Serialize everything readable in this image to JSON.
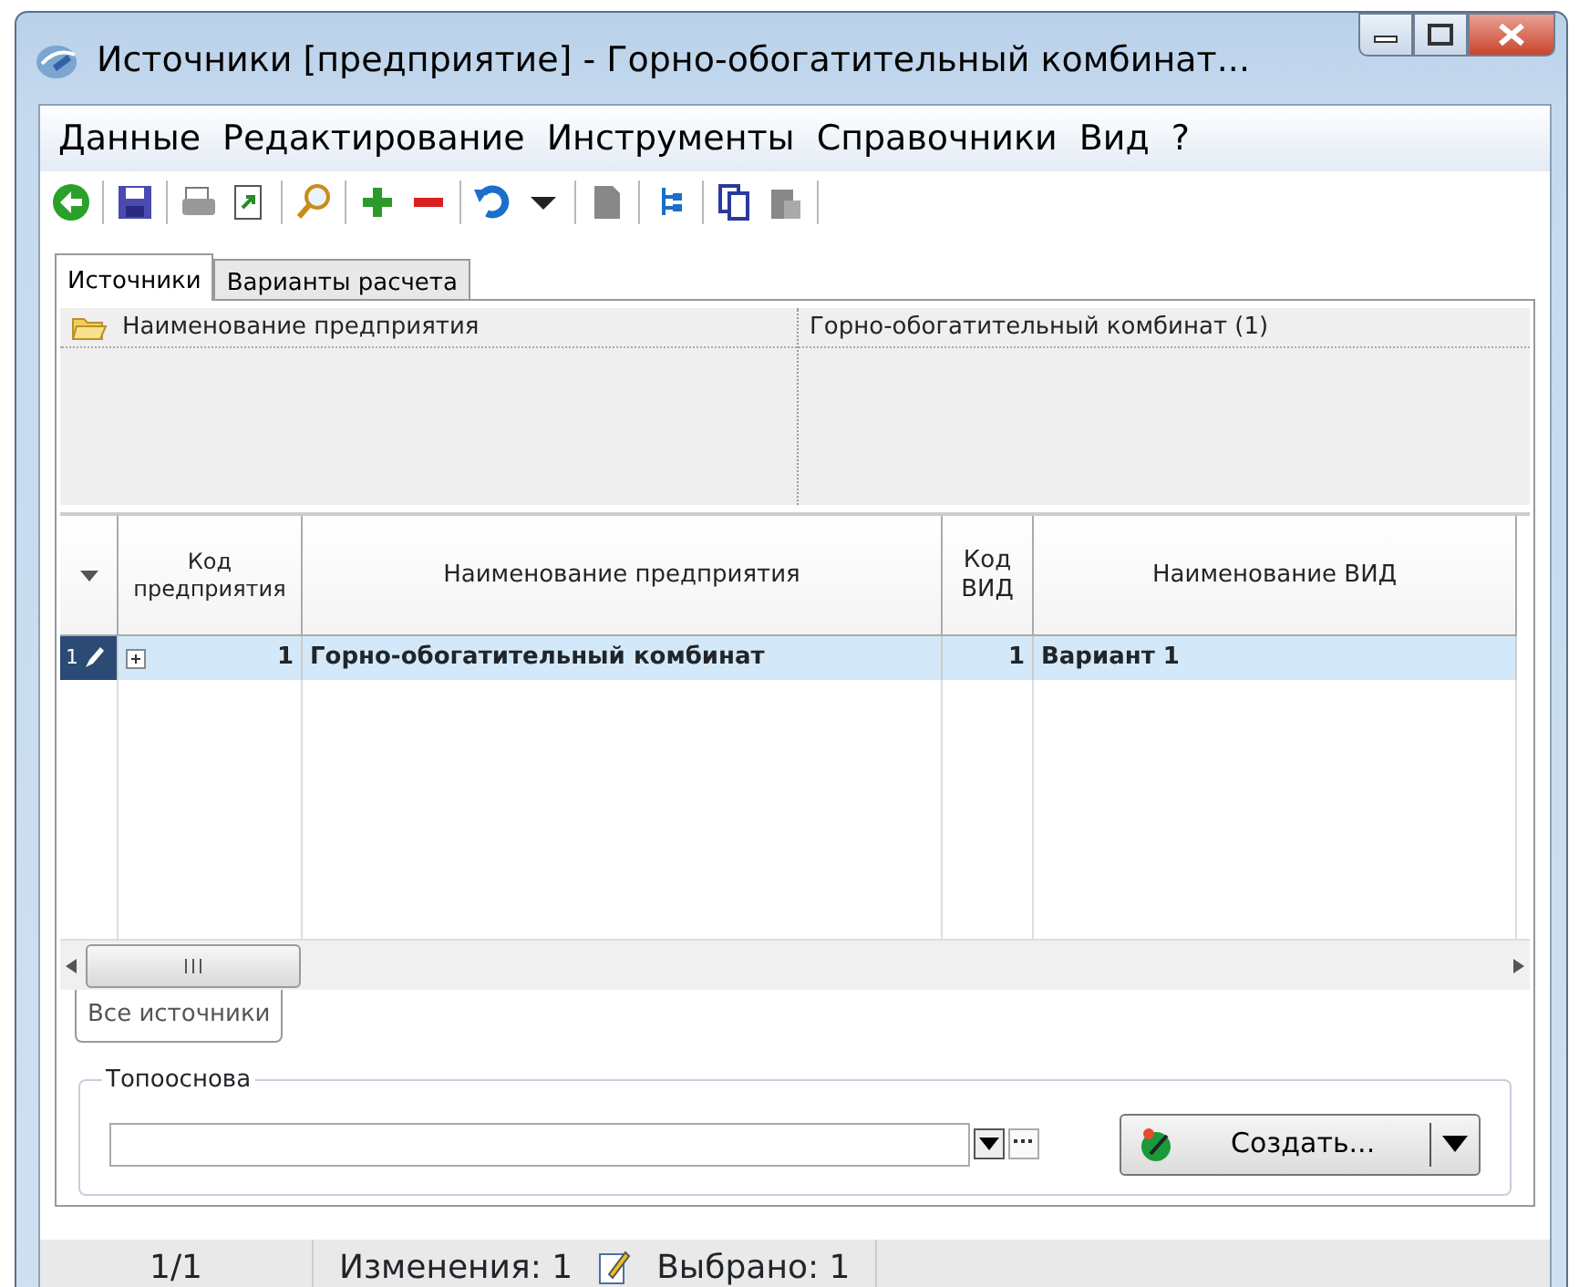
{
  "window": {
    "title": "Источники [предприятие] - Горно-обогатительный комбинат..."
  },
  "menu": [
    "Данные",
    "Редактирование",
    "Инструменты",
    "Справочники",
    "Вид",
    "?"
  ],
  "tabs": [
    {
      "label": "Источники",
      "selected": true
    },
    {
      "label": "Варианты расчета",
      "selected": false
    }
  ],
  "group_panel": {
    "column": "Наименование предприятия",
    "value": "Горно-обогатительный комбинат (1)"
  },
  "table": {
    "columns": [
      "Код предприятия",
      "Наименование предприятия",
      "Код ВИД",
      "Наименование ВИД"
    ],
    "rows": [
      {
        "number": "1",
        "selected": true,
        "expanded": false,
        "cells": [
          "1",
          "Горно-обогатительный комбинат",
          "1",
          "Вариант 1"
        ]
      }
    ]
  },
  "bottom_tabs": [
    {
      "label": "Все источники",
      "selected": true
    }
  ],
  "topooснова": {
    "label": "Топооснова"
  },
  "create_button": {
    "label": "Создать..."
  },
  "status_bar": {
    "position": "1/1",
    "changes": "Изменения: 1",
    "selected": "Выбрано: 1"
  }
}
